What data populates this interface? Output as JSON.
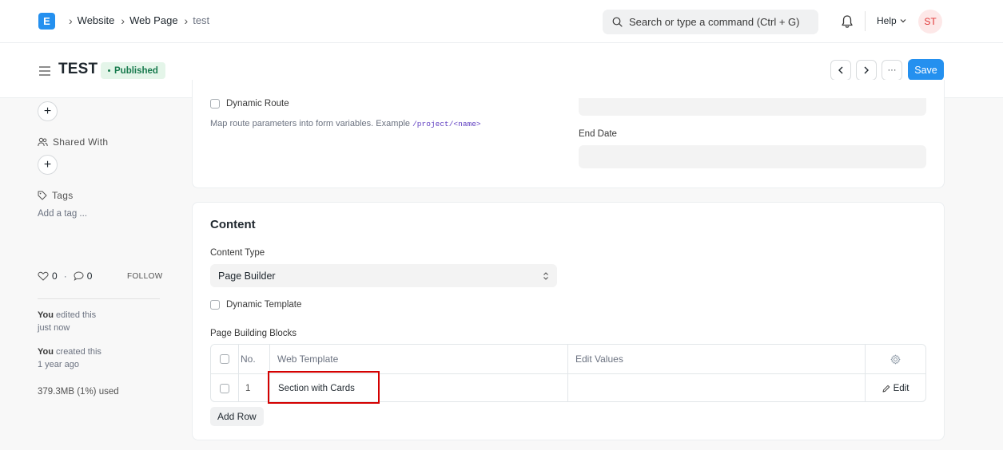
{
  "breadcrumbs": [
    "Website",
    "Web Page",
    "test"
  ],
  "navbar": {
    "logo_letter": "E",
    "search_placeholder": "Search or type a command (Ctrl + G)",
    "help_label": "Help",
    "avatar_initials": "ST"
  },
  "page": {
    "title": "TEST",
    "status": "Published",
    "save_label": "Save",
    "more_label": "···"
  },
  "sidebar": {
    "shared_with_label": "Shared With",
    "tags_label": "Tags",
    "add_tag_label": "Add a tag ...",
    "likes": "0",
    "comments": "0",
    "separator": "·",
    "follow_label": "FOLLOW",
    "activity": [
      {
        "who": "You",
        "action": "edited this",
        "when": "just now"
      },
      {
        "who": "You",
        "action": "created this",
        "when": "1 year ago"
      }
    ],
    "usage": "379.3MB (1%) used"
  },
  "route_section": {
    "dynamic_route_label": "Dynamic Route",
    "description": "Map route parameters into form variables. Example ",
    "example_code": "/project/<name>",
    "end_date_label": "End Date"
  },
  "content_section": {
    "heading": "Content",
    "content_type_label": "Content Type",
    "content_type_value": "Page Builder",
    "dynamic_template_label": "Dynamic Template",
    "blocks_label": "Page Building Blocks",
    "table": {
      "headers": {
        "no": "No.",
        "web_template": "Web Template",
        "edit_values": "Edit Values"
      },
      "rows": [
        {
          "no": "1",
          "web_template": "Section with Cards",
          "edit_values": "",
          "edit_label": "Edit"
        }
      ]
    },
    "add_row_label": "Add Row"
  },
  "colors": {
    "primary": "#2490ef",
    "published_bg": "#e4f5e9",
    "published_text": "#16794c",
    "highlight": "#d40000"
  }
}
